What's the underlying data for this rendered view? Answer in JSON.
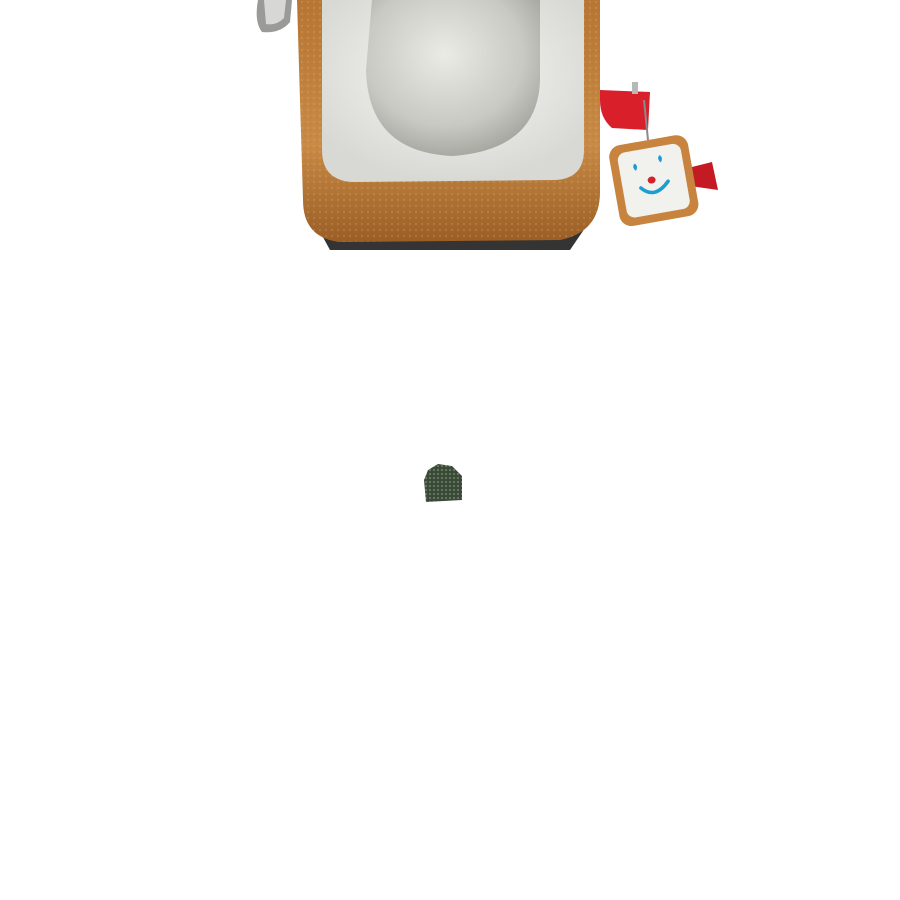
{
  "scene": {
    "background_color": "#ffffff",
    "subject": "bread-loaf-character",
    "crust_color": "#c8843f",
    "crumb_color": "#efefed",
    "tag_face": {
      "eyes_color": "#1a9fd0",
      "nose_color": "#d0242a",
      "mouth_color": "#1a9fd0"
    },
    "ribbon_color": "#d81f2a",
    "stray_object_color": "#3a4a3a"
  }
}
